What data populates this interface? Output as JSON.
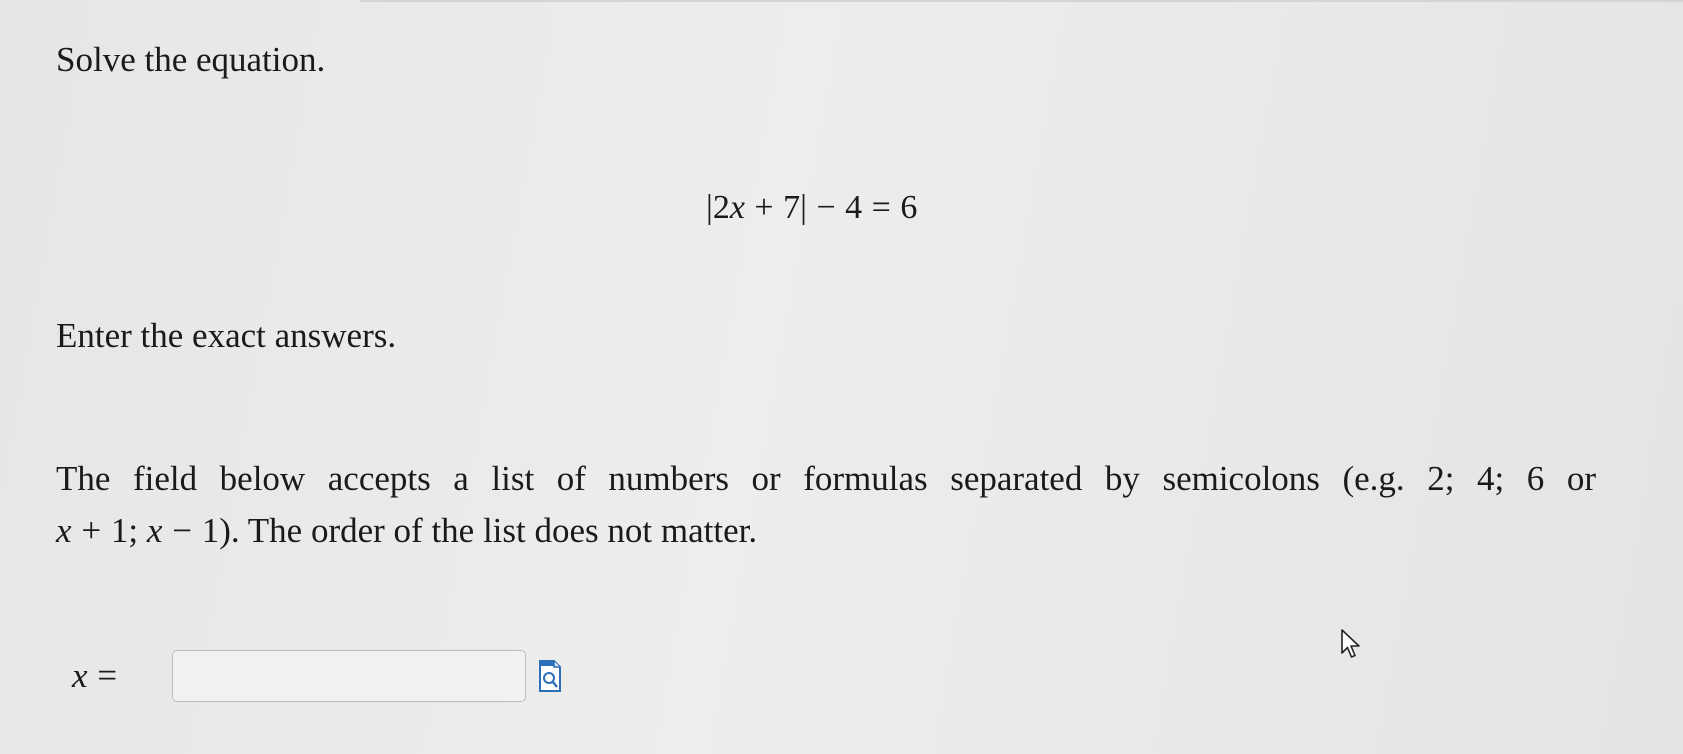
{
  "question": {
    "prompt": "Solve the equation.",
    "equation": {
      "abs_open": "|",
      "coef": "2",
      "var": "x",
      "plus": "+",
      "const": "7",
      "abs_close": "|",
      "minus": "−",
      "sub": "4",
      "equals": "=",
      "rhs": "6"
    },
    "instructions": "Enter the exact answers.",
    "field_help": {
      "line1": "The field below accepts a list of numbers or formulas separated by semicolons (e.g. 2; 4; 6 or",
      "ex1_var": "x",
      "ex1_op": "+",
      "ex1_num": "1;",
      "ex2_var": "x",
      "ex2_op": "−",
      "ex2_num": "1",
      "tail": "). The order of the list does not matter."
    }
  },
  "answer": {
    "label_var": "x",
    "label_eq": "=",
    "value": "",
    "placeholder": ""
  },
  "icons": {
    "preview": "preview-icon",
    "cursor": "mouse-pointer-icon"
  },
  "colors": {
    "accent": "#2a6fb8",
    "input_border": "#b9bcc2"
  }
}
